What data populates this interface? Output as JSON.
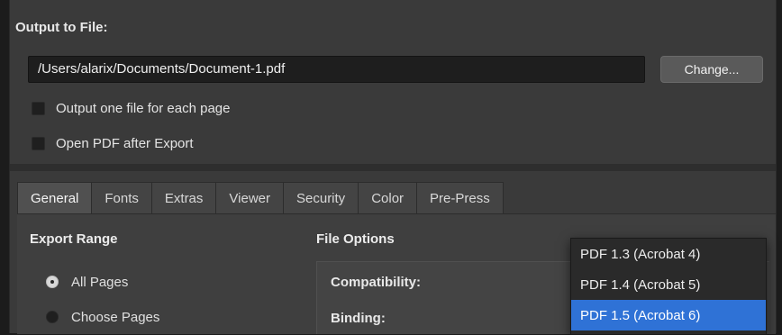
{
  "output": {
    "section_label": "Output to File:",
    "path_value": "/Users/alarix/Documents/Document-1.pdf",
    "change_button": "Change...",
    "checkboxes": [
      {
        "label": "Output one file for each page",
        "checked": false
      },
      {
        "label": "Open PDF after Export",
        "checked": false
      }
    ]
  },
  "tabs": [
    {
      "label": "General",
      "active": true
    },
    {
      "label": "Fonts",
      "active": false
    },
    {
      "label": "Extras",
      "active": false
    },
    {
      "label": "Viewer",
      "active": false
    },
    {
      "label": "Security",
      "active": false
    },
    {
      "label": "Color",
      "active": false
    },
    {
      "label": "Pre-Press",
      "active": false
    }
  ],
  "general": {
    "export_range_label": "Export Range",
    "radios": [
      {
        "label": "All Pages",
        "selected": true
      },
      {
        "label": "Choose Pages",
        "selected": false
      }
    ],
    "file_options_label": "File Options",
    "compatibility_label": "Compatibility:",
    "binding_label": "Binding:"
  },
  "compatibility_dropdown": {
    "options": [
      "PDF 1.3 (Acrobat 4)",
      "PDF 1.4 (Acrobat 5)",
      "PDF 1.5 (Acrobat 6)"
    ],
    "selected_index": 2
  },
  "colors": {
    "accent": "#2f72d6",
    "panel": "#3a3a3a",
    "field": "#1e1e1e"
  }
}
